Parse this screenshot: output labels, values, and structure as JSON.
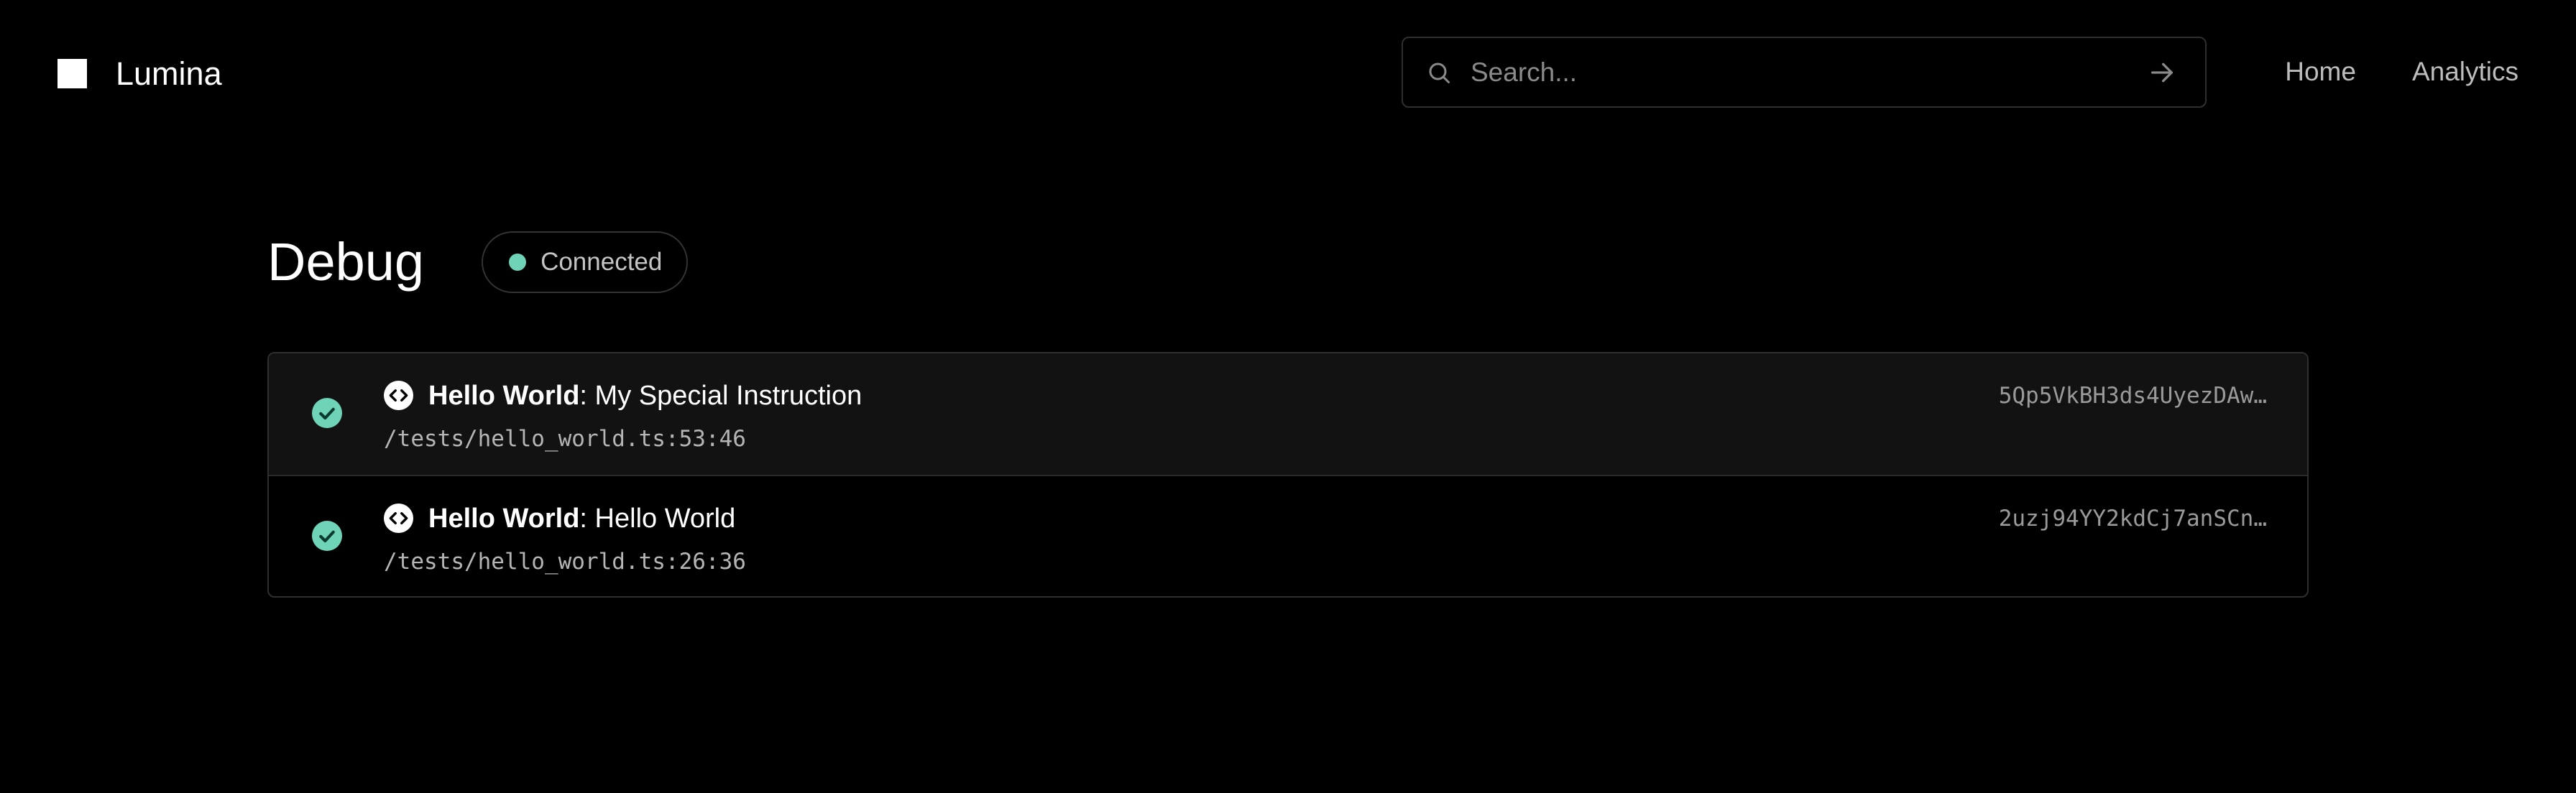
{
  "header": {
    "brand": "Lumina",
    "search": {
      "placeholder": "Search...",
      "value": ""
    },
    "nav": [
      {
        "label": "Home"
      },
      {
        "label": "Analytics"
      }
    ]
  },
  "main": {
    "title": "Debug",
    "status": {
      "label": "Connected",
      "color": "#6fd3b7"
    },
    "runs": [
      {
        "suite": "Hello World",
        "separator": ": ",
        "name": "My Special Instruction",
        "path": "/tests/hello_world.ts:53:46",
        "hash": "5Qp5VkBH3ds4UyezDAw…",
        "status": "passed",
        "icon": "code-icon"
      },
      {
        "suite": "Hello World",
        "separator": ": ",
        "name": "Hello World",
        "path": "/tests/hello_world.ts:26:36",
        "hash": "2uzj94YY2kdCj7anSCn…",
        "status": "passed",
        "icon": "code-icon"
      }
    ]
  },
  "colors": {
    "background": "#000000",
    "accent": "#6fd3b7",
    "border": "#2f2f2f",
    "row_highlight": "#121212"
  }
}
